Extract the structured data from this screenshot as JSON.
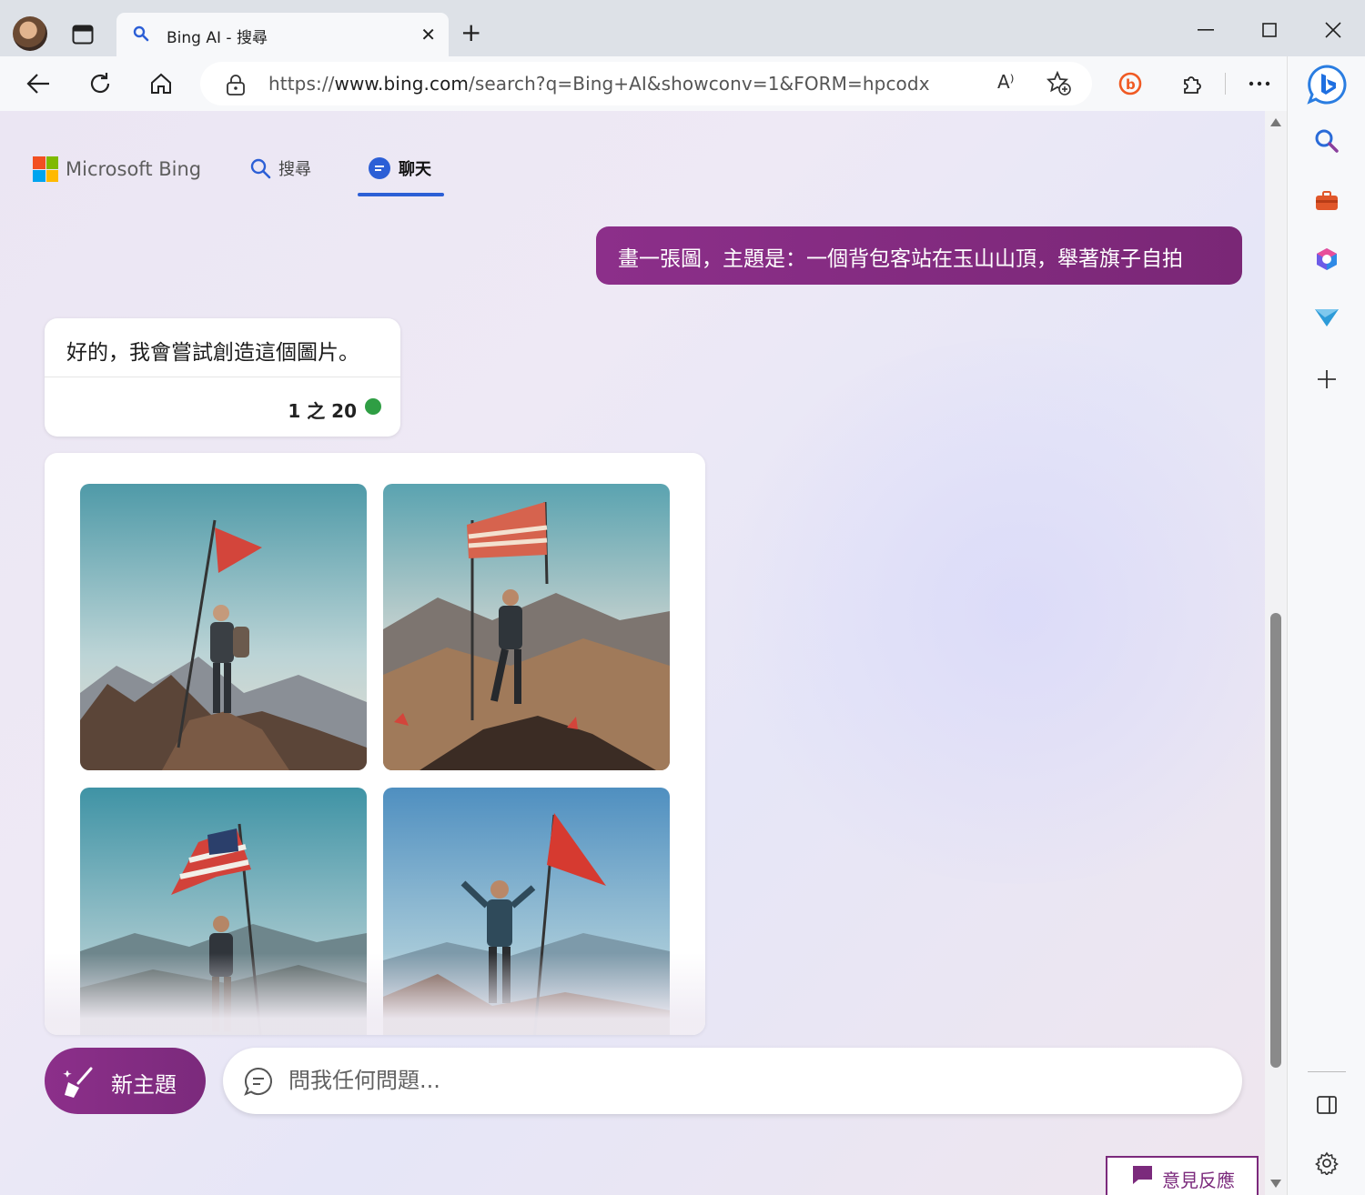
{
  "browser": {
    "tab_title": "Bing AI - 搜尋",
    "url_prefix": "https://",
    "url_domain": "www.bing.com",
    "url_path": "/search?q=Bing+AI&showconv=1&FORM=hpcodx",
    "read_aloud": "A⁾"
  },
  "icons": {
    "window_minimize": "minimize-icon",
    "window_maximize": "maximize-icon",
    "window_close": "close-icon"
  },
  "bing": {
    "brand_name": "Microsoft Bing",
    "nav": [
      {
        "label": "搜尋"
      },
      {
        "label": "聊天"
      }
    ]
  },
  "conversation": {
    "user_message": "畫一張圖，主題是：一個背包客站在玉山山頂，舉著旗子自拍",
    "bot_message": "好的，我會嘗試創造這個圖片。",
    "turn_counter": "1 之 20",
    "status_color": "#2f9e44"
  },
  "input": {
    "new_topic_label": "新主題",
    "placeholder": "問我任何問題..."
  },
  "feedback_label": "意見反應",
  "colors": {
    "accent_purple": "#8c2f8a",
    "active_tab_underline": "#2c5fd6"
  }
}
